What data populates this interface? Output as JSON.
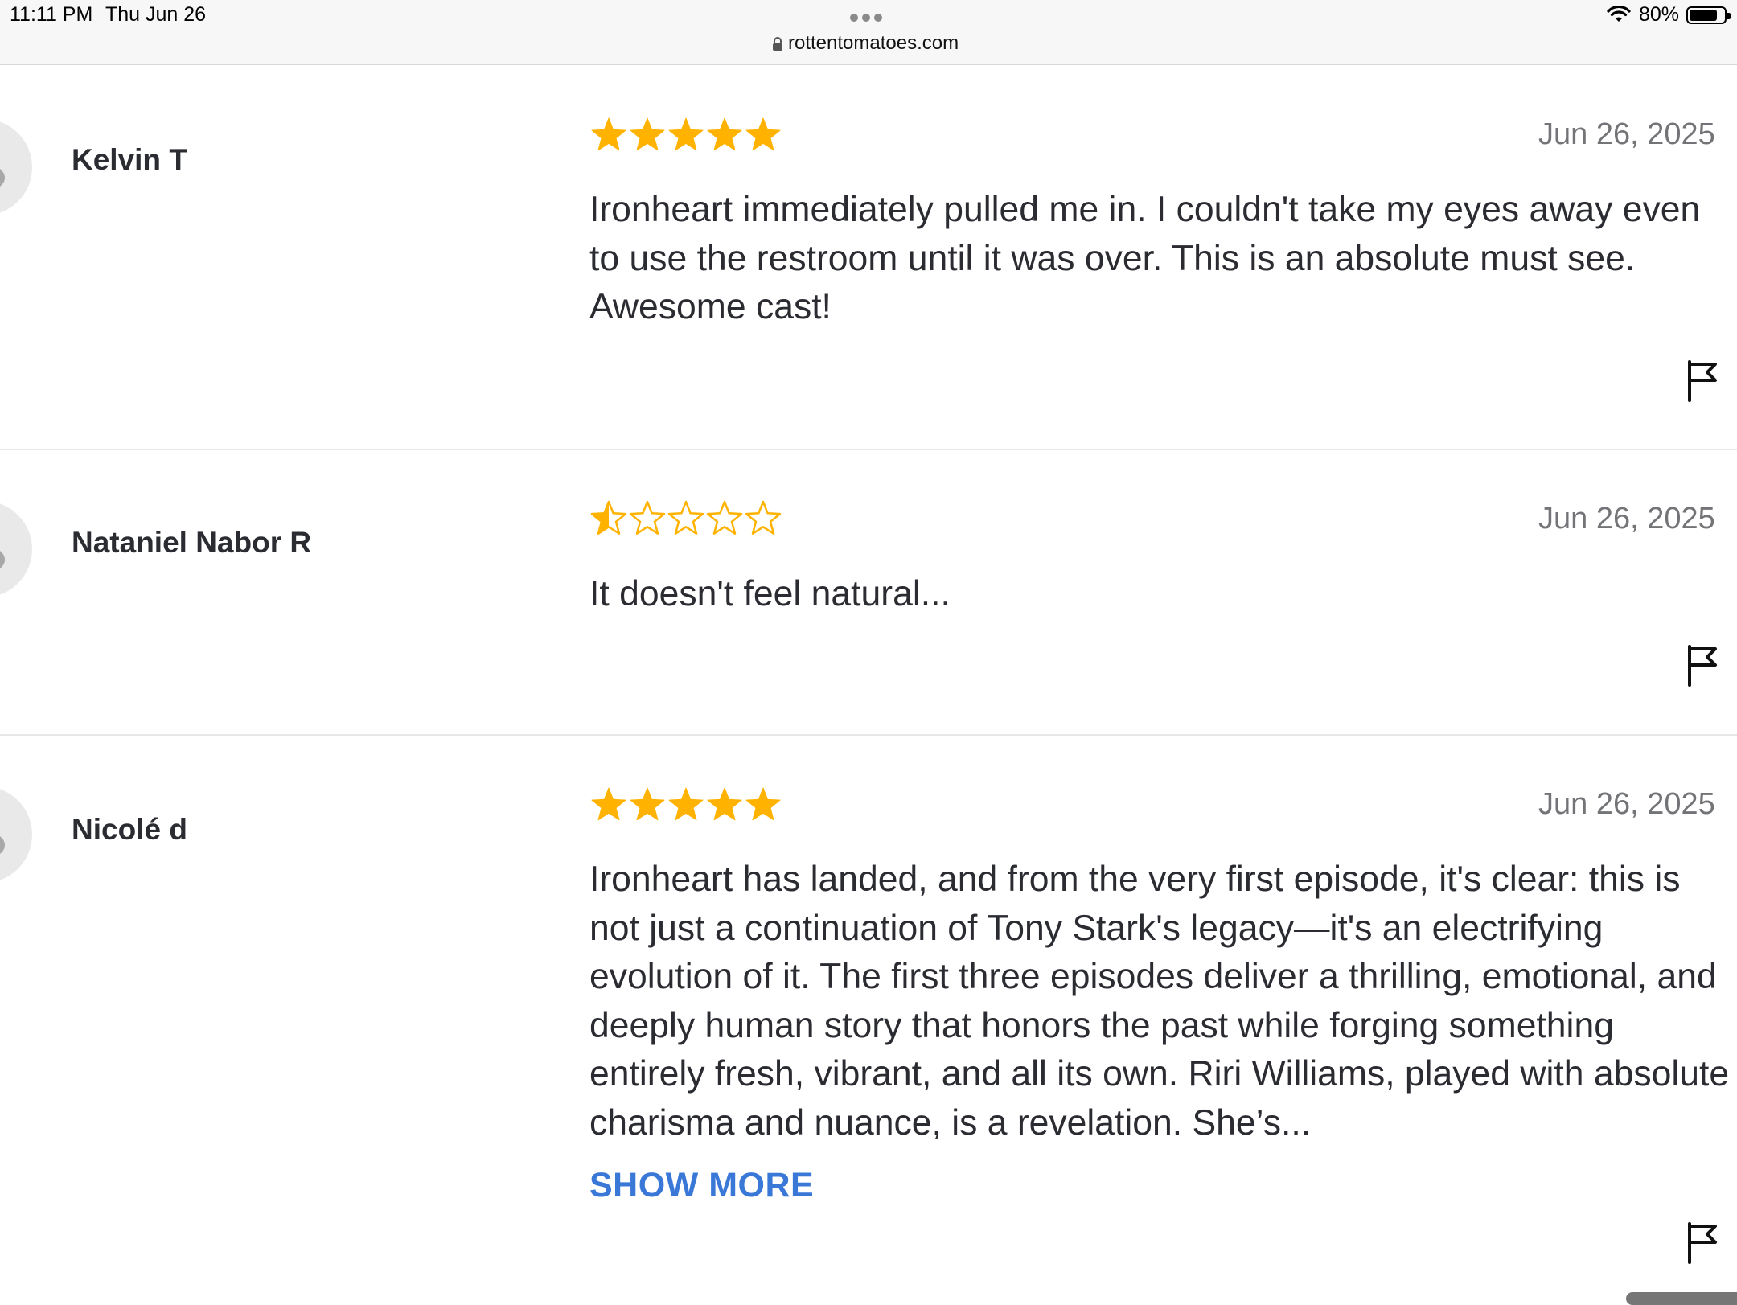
{
  "status_bar": {
    "time": "11:11 PM",
    "date": "Thu Jun 26",
    "url": "rottentomatoes.com",
    "battery_percent": "80%",
    "battery_level": 0.8
  },
  "colors": {
    "star": "#FFB300",
    "link": "#3A78D8",
    "text": "#2A2C32",
    "date": "#737477"
  },
  "reviews": [
    {
      "name": "Kelvin T",
      "rating": 5,
      "date": "Jun 26, 2025",
      "text": "Ironheart immediately pulled me in. I couldn't take my eyes away even to use the restroom until it was over. This is an absolute must see. Awesome cast!"
    },
    {
      "name": "Nataniel Nabor R",
      "rating": 0.5,
      "date": "Jun 26, 2025",
      "text": "It doesn't feel natural..."
    },
    {
      "name": "Nicolé d",
      "rating": 5,
      "date": "Jun 26, 2025",
      "text": "Ironheart has landed, and from the very first episode, it's clear: this is not just a continuation of Tony Stark's legacy—it's an electrifying evolution of it. The first three episodes deliver a thrilling, emotional, and deeply human story that honors the past while forging something entirely fresh, vibrant, and all its own. Riri Williams, played with absolute charisma and nuance, is a revelation. She’s...",
      "show_more_label": "SHOW MORE"
    }
  ]
}
